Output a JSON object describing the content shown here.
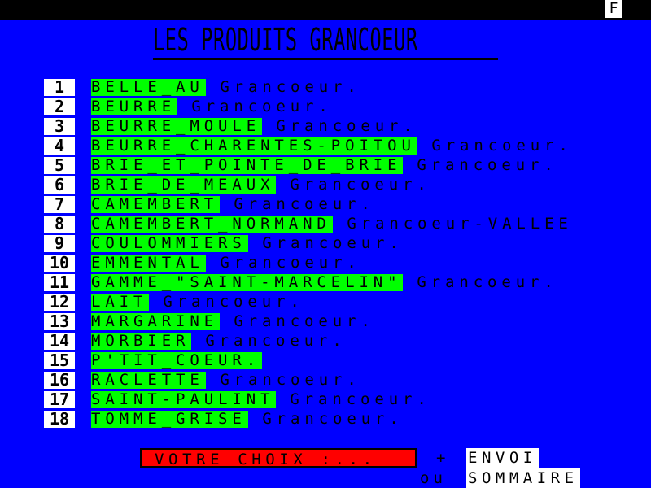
{
  "status": {
    "indicator": "F"
  },
  "page": {
    "title": "LES PRODUITS GRANCOEUR"
  },
  "products": [
    {
      "num": "1",
      "name": "BELLE_AU",
      "brand": " Grancoeur."
    },
    {
      "num": "2",
      "name": "BEURRE",
      "brand": " Grancoeur."
    },
    {
      "num": "3",
      "name": "BEURRE_MOULE",
      "brand": " Grancoeur."
    },
    {
      "num": "4",
      "name": "BEURRE_CHARENTES-POITOU",
      "brand": " Grancoeur."
    },
    {
      "num": "5",
      "name": "BRIE_ET_POINTE_DE_BRIE",
      "brand": " Grancoeur."
    },
    {
      "num": "6",
      "name": "BRIE_DE_MEAUX",
      "brand": " Grancoeur."
    },
    {
      "num": "7",
      "name": "CAMEMBERT",
      "brand": " Grancoeur."
    },
    {
      "num": "8",
      "name": "CAMEMBERT_NORMAND",
      "brand": " Grancoeur-VALLEE"
    },
    {
      "num": "9",
      "name": "COULOMMIERS",
      "brand": " Grancoeur."
    },
    {
      "num": "10",
      "name": "EMMENTAL",
      "brand": " Grancoeur."
    },
    {
      "num": "11",
      "name": "GAMME_\"SAINT-MARCELIN\"",
      "brand": " Grancoeur."
    },
    {
      "num": "12",
      "name": "LAIT",
      "brand": " Grancoeur."
    },
    {
      "num": "13",
      "name": "MARGARINE",
      "brand": " Grancoeur."
    },
    {
      "num": "14",
      "name": "MORBIER",
      "brand": " Grancoeur."
    },
    {
      "num": "15",
      "name": "P'TIT_COEUR.",
      "brand": ""
    },
    {
      "num": "16",
      "name": "RACLETTE",
      "brand": " Grancoeur."
    },
    {
      "num": "17",
      "name": "SAINT-PAULINT",
      "brand": " Grancoeur."
    },
    {
      "num": "18",
      "name": "TOMME_GRISE",
      "brand": " Grancoeur."
    }
  ],
  "footer": {
    "choice_label": "VOTRE CHOIX :...",
    "plus": "+",
    "envoi": "ENVOI",
    "ou": "ou",
    "sommaire": "SOMMAIRE"
  },
  "colors": {
    "background": "#0000ff",
    "product_highlight": "#00ff00",
    "choice_field": "#ff0000",
    "number_box": "#ffffff"
  }
}
